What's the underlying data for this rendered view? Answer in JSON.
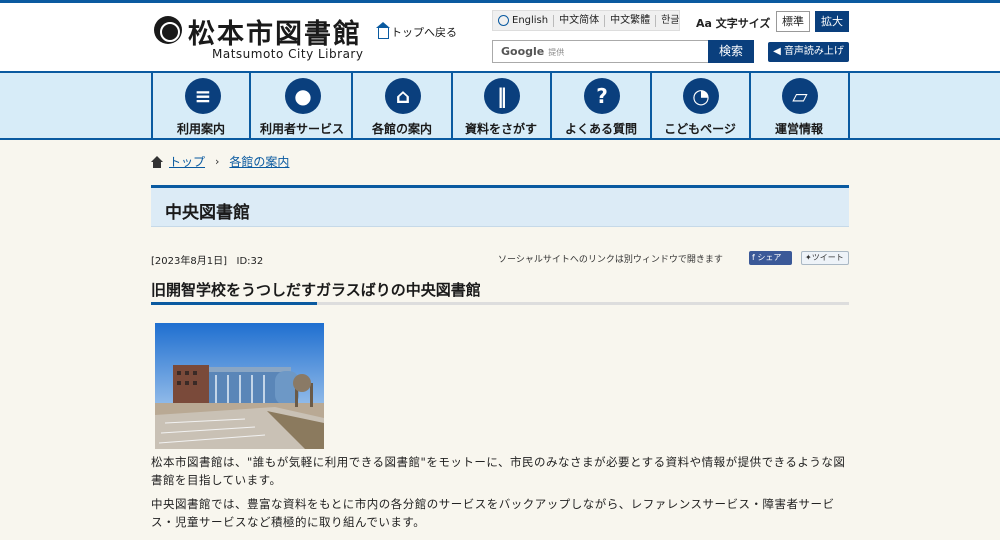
{
  "header": {
    "site_title": "松本市図書館",
    "site_subtitle": "Matsumoto City Library",
    "top_link": "トップへ戻る",
    "languages": [
      "English",
      "中文简体",
      "中文繁體",
      "한글"
    ],
    "font_size_label": "文字サイズ",
    "font_size_standard": "標準",
    "font_size_large": "拡大",
    "search_google": "Google",
    "search_provided": "提供",
    "search_button": "検索",
    "voice_button": "音声読み上げ"
  },
  "nav": {
    "items": [
      {
        "label": "利用案内",
        "icon": "document-icon"
      },
      {
        "label": "利用者サービス",
        "icon": "user-icon"
      },
      {
        "label": "各館の案内",
        "icon": "building-icon"
      },
      {
        "label": "資料をさがす",
        "icon": "books-icon"
      },
      {
        "label": "よくある質問",
        "icon": "question-icon"
      },
      {
        "label": "こどもページ",
        "icon": "duck-icon"
      },
      {
        "label": "運営情報",
        "icon": "folder-icon"
      }
    ]
  },
  "breadcrumb": {
    "home": "トップ",
    "current": "各館の案内"
  },
  "page": {
    "title": "中央図書館",
    "date": "[2023年8月1日]",
    "id": "ID:32",
    "social_note": "ソーシャルサイトへのリンクは別ウィンドウで開きます",
    "share_label": "シェア",
    "tweet_label": "ツイート",
    "article_title": "旧開智学校をうつしだすガラスばりの中央図書館",
    "para1": "松本市図書館は、\"誰もが気軽に利用できる図書館\"をモットーに、市民のみなさまが必要とする資料や情報が提供できるような図書館を目指しています。",
    "para2": "中央図書館では、豊富な資料をもとに市内の各分館のサービスをバックアップしながら、レファレンスサービス・障害者サービス・児童サービスなど積極的に取り組んでいます。"
  },
  "colors": {
    "primary": "#0a5aa0",
    "dark": "#0a3f7d",
    "nav_bg": "#d7ecf8",
    "page_bg": "#f8f6ee"
  }
}
